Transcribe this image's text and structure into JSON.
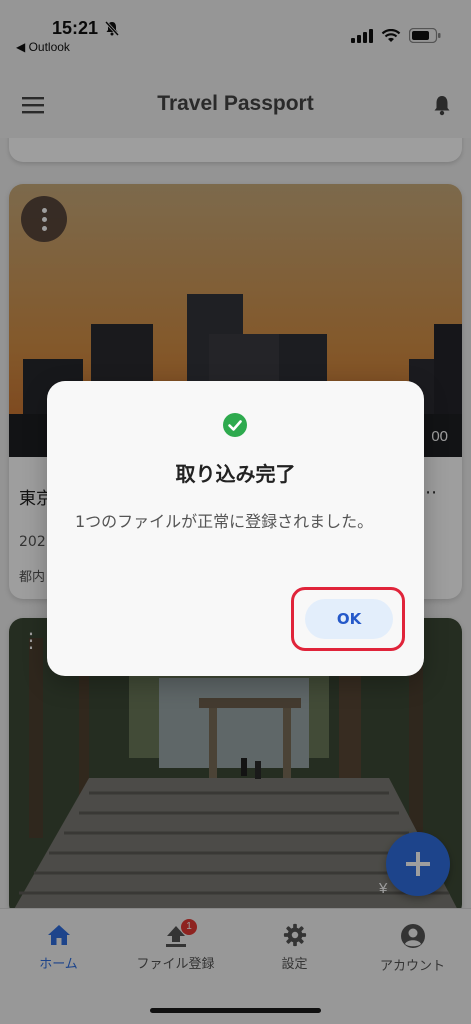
{
  "status_bar": {
    "time": "15:21",
    "back_app": "◀ Outlook"
  },
  "app_bar": {
    "title": "Travel Passport"
  },
  "cards": [
    {
      "title": "東京",
      "date": "202",
      "location": "都内",
      "price": "00"
    },
    {
      "price": "¥"
    }
  ],
  "bottom_nav": {
    "items": [
      {
        "label": "ホーム"
      },
      {
        "label": "ファイル登録",
        "badge": "1"
      },
      {
        "label": "設定"
      },
      {
        "label": "アカウント"
      }
    ]
  },
  "dialog": {
    "title": "取り込み完了",
    "message": "1つのファイルが正常に登録されました。",
    "ok_label": "OK"
  },
  "colors": {
    "accent": "#2f6fe0",
    "success": "#2eaa4e",
    "highlight": "#e0243a",
    "badge": "#e53935"
  }
}
